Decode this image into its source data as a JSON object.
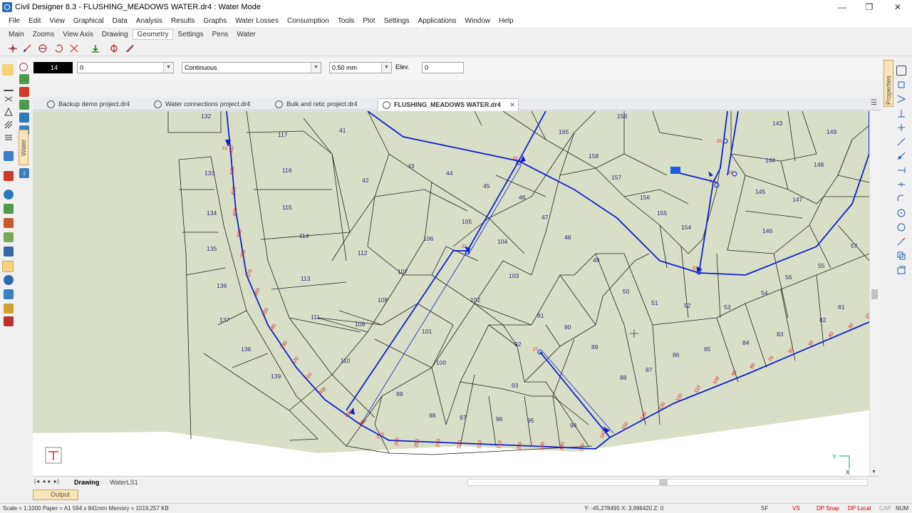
{
  "window": {
    "title": "Civil Designer 8.3 - FLUSHING_MEADOWS WATER.dr4 : Water Mode",
    "minimize": "—",
    "maximize": "❐",
    "close": "✕"
  },
  "menu": [
    "File",
    "Edit",
    "View",
    "Graphical",
    "Data",
    "Analysis",
    "Results",
    "Graphs",
    "Water Losses",
    "Consumption",
    "Tools",
    "Plot",
    "Settings",
    "Applications",
    "Window",
    "Help"
  ],
  "ribbon_tabs": [
    "Main",
    "Zooms",
    "View Axis",
    "Drawing",
    "Geometry",
    "Settings",
    "Pens",
    "Water"
  ],
  "ribbon_active": "Geometry",
  "properties": {
    "color_value": "14",
    "layer_value": "0",
    "linetype_value": "Continuous",
    "lineweight_value": "0.50 mm",
    "elev_label": "Elev.",
    "elev_value": "0"
  },
  "doc_tabs": [
    {
      "label": "Backup demo project.dr4"
    },
    {
      "label": "Water connections project.dr4"
    },
    {
      "label": "Bulk and retic project.dr4"
    },
    {
      "label": "FLUSHING_MEADOWS WATER.dr4",
      "active": true
    }
  ],
  "side_tabs": {
    "properties": "Properties",
    "water": "Water"
  },
  "bottom_tabs": {
    "drawing": "Drawing",
    "water_ls": "WaterLS1"
  },
  "output_tab": "Output",
  "status": {
    "scale_info": "Scale = 1:1000  Paper = A1 594 x 841mm  Memory = 1019,257 KB",
    "coords": "Y: -45,278495 X: 3,996420 Z: 0",
    "sf": "SF",
    "vs": "VS",
    "dp_snap": "DP Snap",
    "dp_local": "DP Local",
    "cap": "CAP",
    "num": "NUM"
  },
  "drawing": {
    "plot_numbers": [
      "132",
      "117",
      "41",
      "159",
      "165",
      "143",
      "149",
      "133",
      "116",
      "43",
      "44",
      "158",
      "157",
      "144",
      "148",
      "42",
      "45",
      "46",
      "156",
      "155",
      "145",
      "147",
      "134",
      "115",
      "47",
      "154",
      "146",
      "105",
      "104",
      "114",
      "106",
      "48",
      "57",
      "135",
      "112",
      "103",
      "49",
      "56",
      "55",
      "107",
      "50",
      "51",
      "52",
      "53",
      "54",
      "136",
      "113",
      "108",
      "102",
      "91",
      "81",
      "111",
      "109",
      "90",
      "89",
      "82",
      "83",
      "137",
      "101",
      "92",
      "86",
      "85",
      "84",
      "138",
      "110",
      "100",
      "87",
      "139",
      "93",
      "88",
      "99",
      "98",
      "97",
      "96",
      "95",
      "94"
    ],
    "chainage_labels": [
      "430",
      "420",
      "410",
      "400",
      "390",
      "380",
      "370",
      "360",
      "350",
      "340",
      "330",
      "320",
      "310",
      "300",
      "290",
      "280",
      "270",
      "260",
      "250",
      "240",
      "230",
      "220",
      "210",
      "200",
      "190",
      "180",
      "170",
      "160",
      "150",
      "140",
      "130",
      "120",
      "110",
      "100",
      "90",
      "80",
      "70",
      "60",
      "50",
      "40",
      "30",
      "20"
    ],
    "node_labels": [
      "21",
      "31",
      "22",
      "23",
      "27",
      "26",
      "25",
      "24"
    ],
    "axis_y": "Y",
    "axis_x": "X"
  }
}
